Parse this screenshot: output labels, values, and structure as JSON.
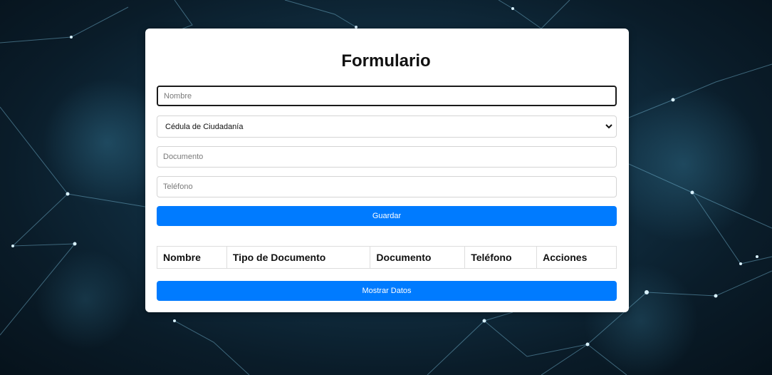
{
  "form": {
    "title": "Formulario",
    "nombre_placeholder": "Nombre",
    "tipo_documento_selected": "Cédula de Ciudadanía",
    "documento_placeholder": "Documento",
    "telefono_placeholder": "Teléfono",
    "guardar_label": "Guardar"
  },
  "table": {
    "headers": [
      "Nombre",
      "Tipo de Documento",
      "Documento",
      "Teléfono",
      "Acciones"
    ]
  },
  "mostrar_label": "Mostrar Datos",
  "colors": {
    "primary": "#007bff",
    "card": "#ffffff",
    "background": "#0a1c29"
  }
}
